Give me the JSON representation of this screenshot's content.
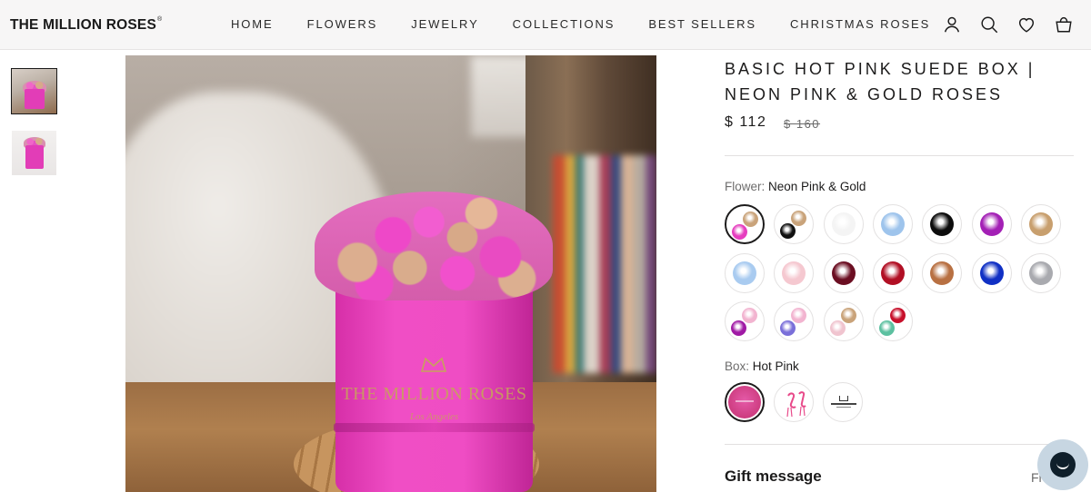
{
  "header": {
    "logo": "THE MILLION ROSES",
    "logo_mark": "®",
    "nav": [
      "HOME",
      "FLOWERS",
      "JEWELRY",
      "COLLECTIONS",
      "BEST SELLERS",
      "CHRISTMAS ROSES"
    ],
    "icons": [
      "account-icon",
      "search-icon",
      "heart-icon",
      "cart-icon"
    ]
  },
  "gallery": {
    "thumbnails": [
      "thumbnail-1",
      "thumbnail-2"
    ],
    "active_index": 0,
    "photo_brand": "THE MILLION ROSES",
    "photo_sub": "Los Angeles"
  },
  "product": {
    "title": "BASIC HOT PINK SUEDE BOX | NEON PINK & GOLD ROSES",
    "price": "$ 112",
    "compare_price": "$ 160",
    "flower_label": "Flower:",
    "flower_value": "Neon Pink & Gold",
    "box_label": "Box:",
    "box_value": "Hot Pink",
    "gift_message": "Gift message",
    "gift_right": "Fr"
  },
  "flower_swatches": [
    {
      "colors": [
        "#c9a37a",
        "#e63ebf"
      ],
      "selected": true
    },
    {
      "colors": [
        "#c9a37a",
        "#111111"
      ]
    },
    {
      "colors": [
        "#f4f4f4"
      ]
    },
    {
      "colors": [
        "#9ec4ec"
      ]
    },
    {
      "colors": [
        "#0d0d0d"
      ]
    },
    {
      "colors": [
        "#a320b5"
      ]
    },
    {
      "colors": [
        "#c89f6e"
      ]
    },
    {
      "colors": [
        "#a9cbf0"
      ]
    },
    {
      "colors": [
        "#f5c8d0"
      ]
    },
    {
      "colors": [
        "#6b0e22"
      ]
    },
    {
      "colors": [
        "#b10f24"
      ]
    },
    {
      "colors": [
        "#b87042"
      ]
    },
    {
      "colors": [
        "#1030c4"
      ]
    },
    {
      "colors": [
        "#a9aaaf"
      ]
    },
    {
      "colors": [
        "#f2b4d0",
        "#a01aa5"
      ]
    },
    {
      "colors": [
        "#f2b4d0",
        "#7a6fd9"
      ]
    },
    {
      "colors": [
        "#c9a37a",
        "#f0c4cf"
      ]
    },
    {
      "colors": [
        "#c7102b",
        "#5cc0a0"
      ]
    }
  ],
  "box_swatches": [
    {
      "type": "hot-pink",
      "selected": true
    },
    {
      "type": "flamingo"
    },
    {
      "type": "white-logo"
    }
  ],
  "colors": {
    "accent_pink": "#e23db7",
    "text": "#1c1b1b",
    "chat_bg": "#c7d6e2"
  }
}
